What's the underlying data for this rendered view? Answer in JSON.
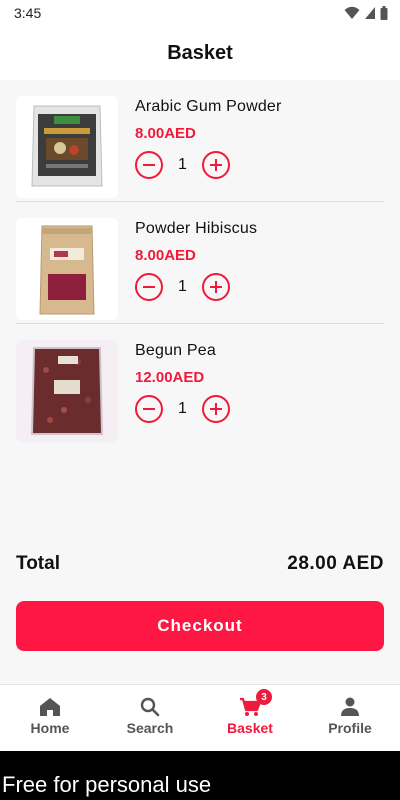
{
  "status_bar": {
    "time": "3:45"
  },
  "header": {
    "title": "Basket"
  },
  "cart": {
    "items": [
      {
        "name": "Arabic Gum Powder",
        "price": "8.00AED",
        "quantity": "1",
        "image_icon": "product-package-dark-icon"
      },
      {
        "name": "Powder Hibiscus",
        "price": "8.00AED",
        "quantity": "1",
        "image_icon": "product-package-kraft-icon"
      },
      {
        "name": "Begun Pea",
        "price": "12.00AED",
        "quantity": "1",
        "image_icon": "product-bag-clear-icon"
      }
    ]
  },
  "summary": {
    "total_label": "Total",
    "total_value": "28.00 AED"
  },
  "checkout": {
    "label": "Checkout"
  },
  "nav": {
    "items": [
      {
        "label": "Home",
        "icon": "home-icon"
      },
      {
        "label": "Search",
        "icon": "search-icon"
      },
      {
        "label": "Basket",
        "icon": "cart-icon",
        "badge": "3",
        "active": true
      },
      {
        "label": "Profile",
        "icon": "person-icon"
      }
    ]
  },
  "watermark": {
    "text": "Free for personal use"
  },
  "colors": {
    "accent": "#ef1a3c",
    "button": "#ff1744",
    "background": "#f7f7f7",
    "nav_inactive": "#555555"
  }
}
